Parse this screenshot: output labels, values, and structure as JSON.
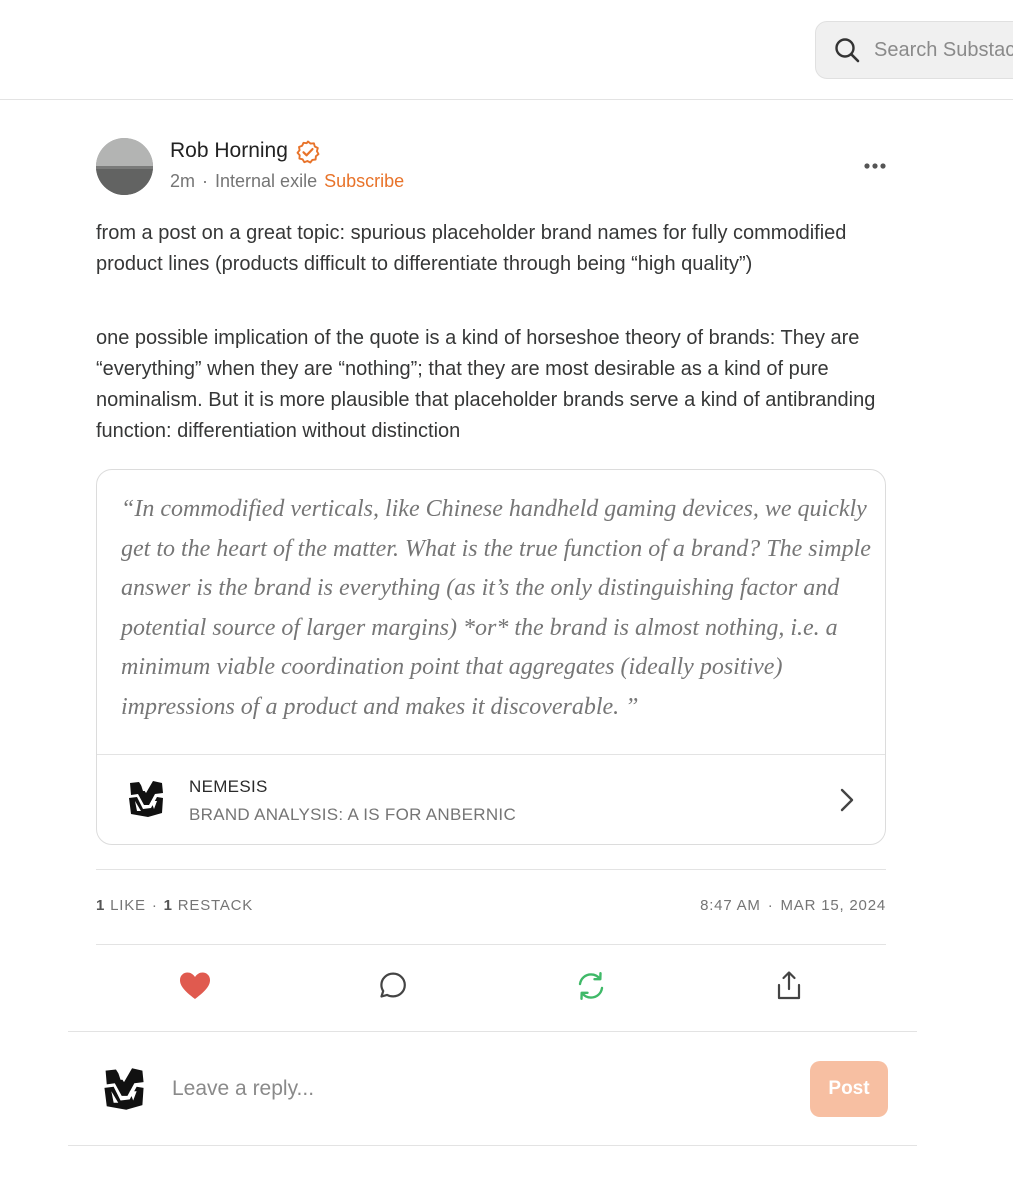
{
  "search": {
    "placeholder": "Search Substack"
  },
  "post": {
    "author": {
      "name": "Rob Horning",
      "verified_color": "#e8732a"
    },
    "meta": {
      "time": "2m",
      "separator": "·",
      "publication": "Internal exile",
      "subscribe_label": "Subscribe"
    },
    "paragraphs": [
      "from a post on a great topic: spurious placeholder brand names for fully commodified product lines (products difficult to differentiate through being “high quality”)",
      "one possible implication of the quote is a kind of horseshoe theory of brands: They are “everything” when they are “nothing”; that they are most desirable as a kind of pure nominalism. But it is more plausible that placeholder brands serve a kind of antibranding function: differentiation without distinction"
    ],
    "quote": {
      "text": "“In commodified verticals, like Chinese handheld gaming devices, we quickly get to the heart of the matter. What is the true function of a brand? The simple answer is the brand is everything (as it’s the only distinguishing factor and potential source of larger margins) *or* the brand is almost nothing, i.e. a minimum viable coordination point that aggregates (ideally positive) impressions of a product and makes it discoverable. ”",
      "source_name": "NEMESIS",
      "source_title": "BRAND ANALYSIS: A IS FOR ANBERNIC"
    },
    "stats": {
      "likes_count": "1",
      "likes_label": "LIKE",
      "separator": "·",
      "restacks_count": "1",
      "restacks_label": "RESTACK",
      "time": "8:47 AM",
      "date": "MAR 15, 2024"
    },
    "actions": {
      "like_color": "#e05a4f",
      "restack_color": "#3fb968",
      "icon_color": "#444444"
    }
  },
  "reply": {
    "placeholder": "Leave a reply...",
    "post_label": "Post",
    "post_button_color": "#f7bfa2"
  },
  "accent_color": "#e8732a"
}
